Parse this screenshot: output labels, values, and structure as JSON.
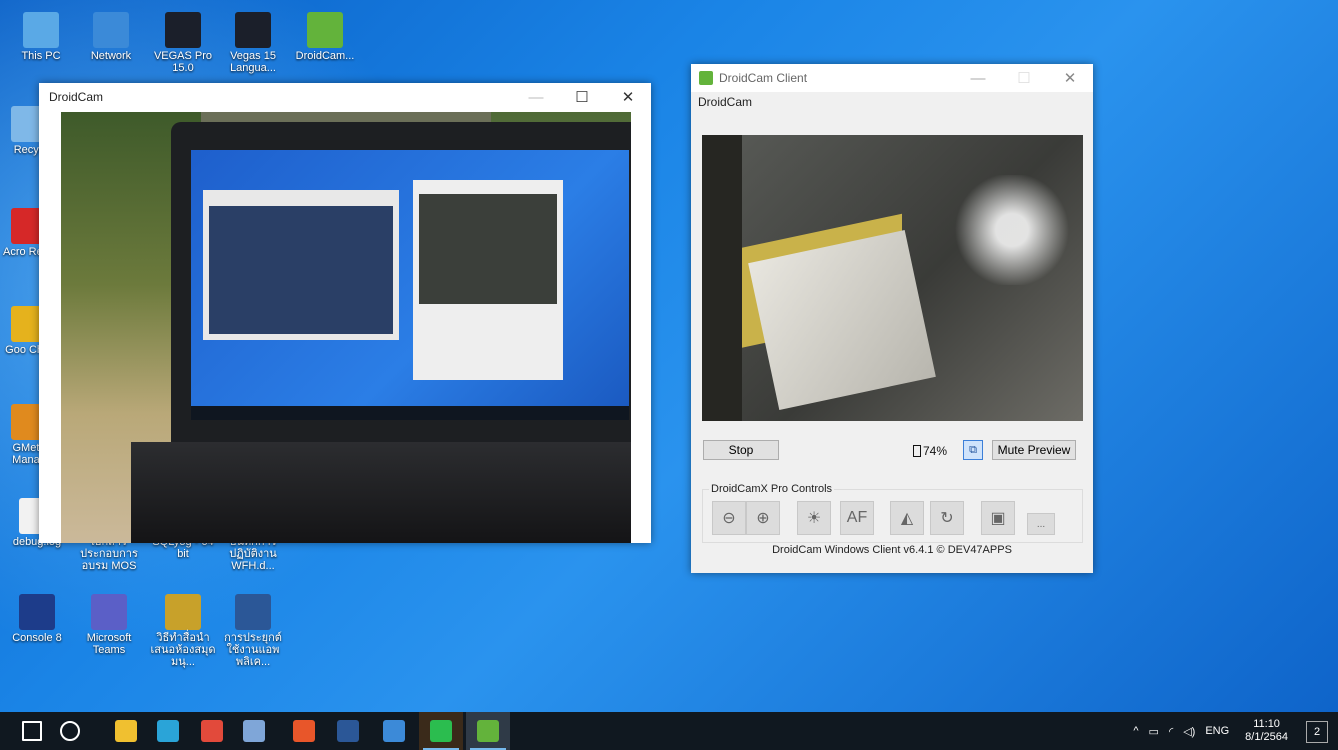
{
  "desktop_icons": [
    {
      "label": "This PC",
      "icon": "this-pc-icon",
      "color": "#5aa9e6"
    },
    {
      "label": "Network",
      "icon": "network-icon",
      "color": "#3b8ad8"
    },
    {
      "label": "VEGAS Pro 15.0",
      "icon": "vegas-icon",
      "color": "#1b1f2a"
    },
    {
      "label": "Vegas 15 Langua...",
      "icon": "vegas-language-icon",
      "color": "#1b1f2a"
    },
    {
      "label": "DroidCam...",
      "icon": "droidcam-icon",
      "color": "#63b33b"
    },
    {
      "label": "Recyc",
      "icon": "recycle-bin-icon",
      "color": "#7fb8e8"
    },
    {
      "label": "Acro Read",
      "icon": "acrobat-icon",
      "color": "#d62828"
    },
    {
      "label": "Goo Chro",
      "icon": "chrome-icon",
      "color": "#e5b21d"
    },
    {
      "label": "GMetri Manag",
      "icon": "gmetrix-icon",
      "color": "#e08a1e"
    },
    {
      "label": "debug.log",
      "icon": "text-file-icon",
      "color": "#f2f2f2"
    },
    {
      "label": "เอกสารประกอบการอบรม MOS",
      "icon": "folder-doc-icon",
      "color": "#f2f2f2"
    },
    {
      "label": "SQLyog - 64 bit",
      "icon": "sqlyog-icon",
      "color": "#f2f2f2"
    },
    {
      "label": "บันทึกการปฏิบัติงาน WFH.d...",
      "icon": "word-doc-icon",
      "color": "#f2f2f2"
    },
    {
      "label": "Console 8",
      "icon": "console-icon",
      "color": "#1d3c8a"
    },
    {
      "label": "Microsoft Teams",
      "icon": "teams-icon",
      "color": "#5b5fc7"
    },
    {
      "label": "วิธีทำสื่อนำเสนอห้องสมุดมนุ...",
      "icon": "winrar-icon",
      "color": "#c8a12a"
    },
    {
      "label": "การประยุกต์ใช้งานแอพพลิเค...",
      "icon": "word-doc-icon",
      "color": "#2b5797"
    }
  ],
  "droidcam_window": {
    "title": "DroidCam",
    "minimize": "—",
    "maximize": "☐",
    "close": "✕"
  },
  "client_window": {
    "title": "DroidCam Client",
    "menu": "DroidCam",
    "stop_label": "Stop",
    "battery": "74%",
    "mute_label": "Mute Preview",
    "controls_label": "DroidCamX Pro Controls",
    "footer": "DroidCam Windows Client v6.4.1 © DEV47APPS",
    "minimize": "—",
    "maximize": "☐",
    "close": "✕"
  },
  "controls": [
    {
      "name": "zoom-out-icon",
      "glyph": "⊖"
    },
    {
      "name": "zoom-in-icon",
      "glyph": "⊕"
    },
    {
      "name": "brightness-icon",
      "glyph": "☀"
    },
    {
      "name": "autofocus-icon",
      "glyph": "AF"
    },
    {
      "name": "flip-icon",
      "glyph": "◭"
    },
    {
      "name": "rotate-icon",
      "glyph": "↻"
    },
    {
      "name": "jpeg-icon",
      "glyph": "▣"
    },
    {
      "name": "more-icon",
      "glyph": "..."
    }
  ],
  "taskbar": {
    "apps": [
      {
        "name": "start-icon",
        "color": "#ffffff"
      },
      {
        "name": "search-icon",
        "color": "#ffffff"
      },
      {
        "name": "file-explorer-icon",
        "color": "#f0c030"
      },
      {
        "name": "edge-icon",
        "color": "#2aa4d8"
      },
      {
        "name": "chrome-icon",
        "color": "#e24a3b"
      },
      {
        "name": "paint-icon",
        "color": "#7fa6d8"
      },
      {
        "name": "office-icon",
        "color": "#e8562a"
      },
      {
        "name": "word-icon",
        "color": "#2b5797"
      },
      {
        "name": "photos-icon",
        "color": "#3c8ad8"
      },
      {
        "name": "line-icon",
        "color": "#2bbd4f"
      },
      {
        "name": "droidcam-taskbar-icon",
        "color": "#63b33b"
      }
    ],
    "tray": {
      "lang": "ENG",
      "time": "11:10",
      "date": "8/1/2564",
      "notif": "2"
    }
  }
}
